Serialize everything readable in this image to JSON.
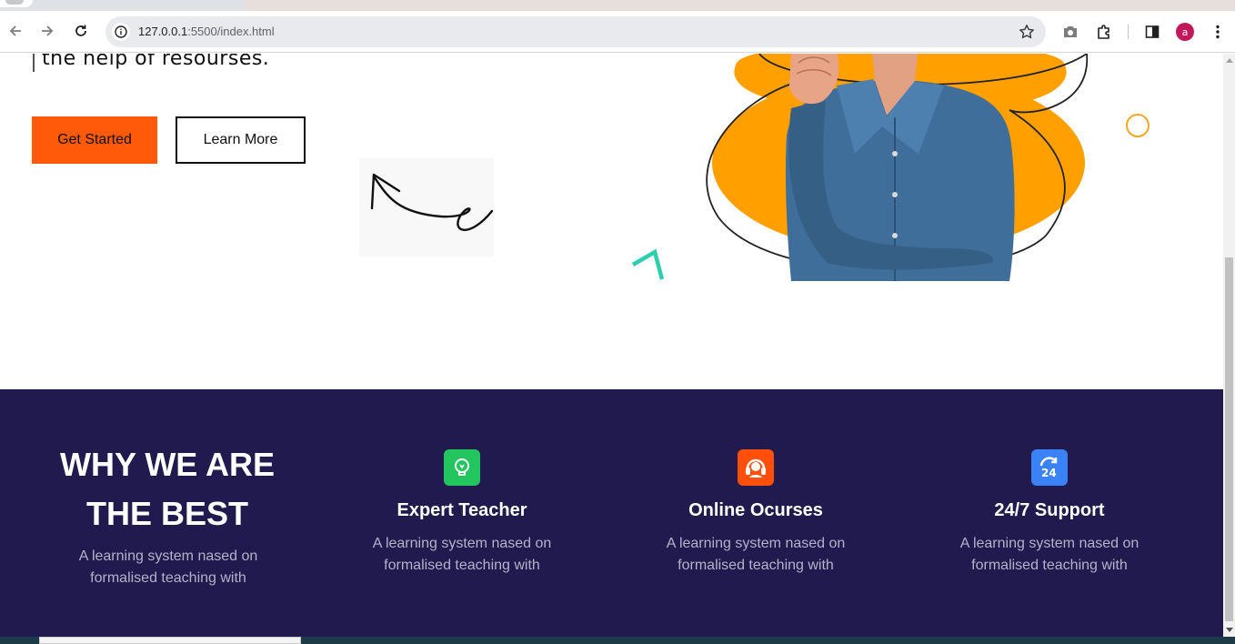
{
  "browser": {
    "url_host": "127.0.0.1",
    "url_path": ":5500/index.html",
    "profile_initial": "a",
    "icons": [
      "back-icon",
      "forward-icon",
      "reload-icon",
      "site-info-icon",
      "bookmark-star-icon",
      "camera-icon",
      "extensions-icon",
      "side-panel-icon",
      "menu-dots-icon"
    ]
  },
  "hero": {
    "text_line": "the help of resourses.",
    "primary_button": "Get Started",
    "secondary_button": "Learn More",
    "accent_color": "#ff5a0a"
  },
  "why": {
    "title": "WHY WE ARE THE BEST",
    "description": "A learning system nased on formalised teaching with",
    "background": "#201a4f"
  },
  "features": [
    {
      "title": "Expert Teacher",
      "description": "A learning system nased on formalised teaching with",
      "icon": "lightbulb-icon",
      "color": "#22c55e"
    },
    {
      "title": "Online Ocurses",
      "description": "A learning system nased on formalised teaching with",
      "icon": "support-agent-icon",
      "color": "#ff4f0a"
    },
    {
      "title": "24/7 Support",
      "description": "A learning system nased on formalised teaching with",
      "icon": "24-hours-icon",
      "color": "#3b82f6"
    }
  ]
}
